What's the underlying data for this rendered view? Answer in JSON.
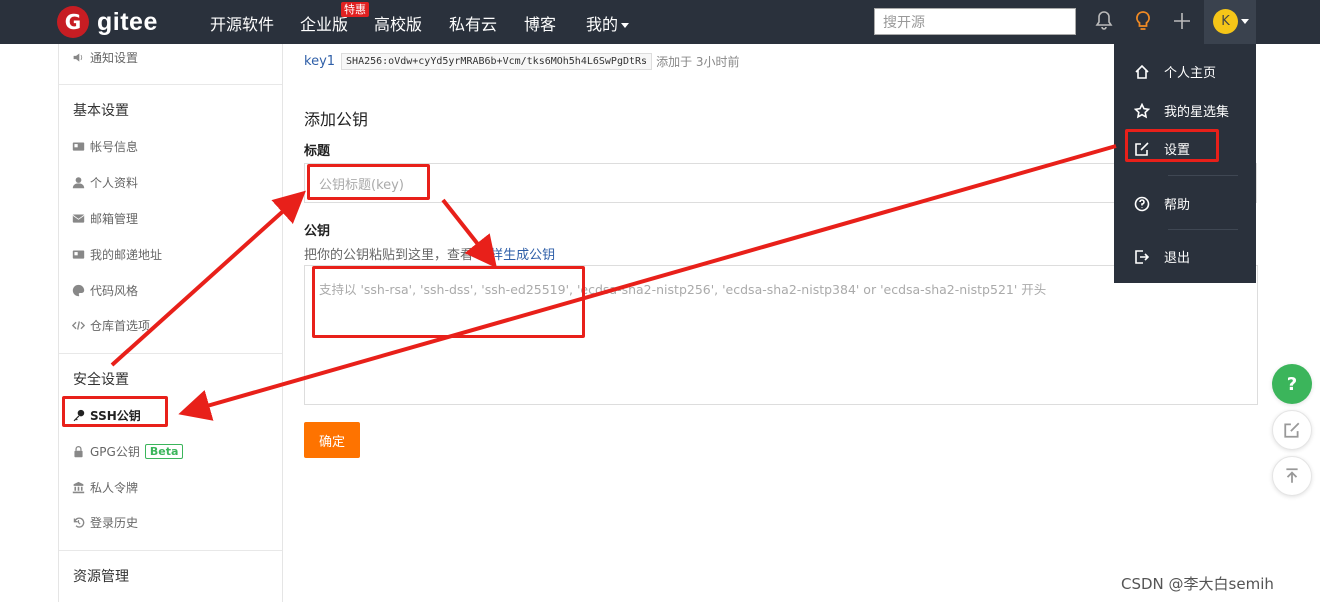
{
  "nav": {
    "logo_letter": "G",
    "logo_text": "gitee",
    "items": [
      "开源软件",
      "企业版",
      "高校版",
      "私有云",
      "博客",
      "我的"
    ],
    "badge": "特惠",
    "search_placeholder": "搜开源",
    "avatar_letter": "K"
  },
  "sidebar": {
    "top_item": "通知设置",
    "basic_heading": "基本设置",
    "basic_items": [
      "帐号信息",
      "个人资料",
      "邮箱管理",
      "我的邮递地址",
      "代码风格",
      "仓库首选项"
    ],
    "security_heading": "安全设置",
    "ssh_label": "SSH公钥",
    "gpg_label": "GPG公钥",
    "beta": "Beta",
    "security_items": [
      "私人令牌",
      "登录历史"
    ],
    "resource_heading": "资源管理"
  },
  "main": {
    "key_name": "key1",
    "key_fingerprint": "SHA256:oVdw+cyYd5yrMRAB6b+Vcm/tks6MOh5h4L6SwPgDtRs",
    "key_added": "添加于 3小时前",
    "section_title": "添加公钥",
    "title_label": "标题",
    "title_placeholder": "公钥标题(key)",
    "key_label": "公钥",
    "hint_prefix": "把你的公钥粘贴到这里，查看",
    "hint_link": "怎样生成公钥",
    "textarea_placeholder": "支持以 'ssh-rsa', 'ssh-dss', 'ssh-ed25519', 'ecdsa-sha2-nistp256', 'ecdsa-sha2-nistp384' or 'ecdsa-sha2-nistp521' 开头",
    "confirm": "确定"
  },
  "dropdown": {
    "items": [
      "个人主页",
      "我的星选集",
      "设置",
      "帮助",
      "退出"
    ]
  },
  "float": {
    "help": "?"
  },
  "watermark": "CSDN @李大白semih",
  "colors": {
    "nav_bg": "#2a313c",
    "brand_red": "#c71d23",
    "confirm": "#fe7300",
    "annotation": "#e8201a",
    "beta_green": "#3bb55b"
  }
}
